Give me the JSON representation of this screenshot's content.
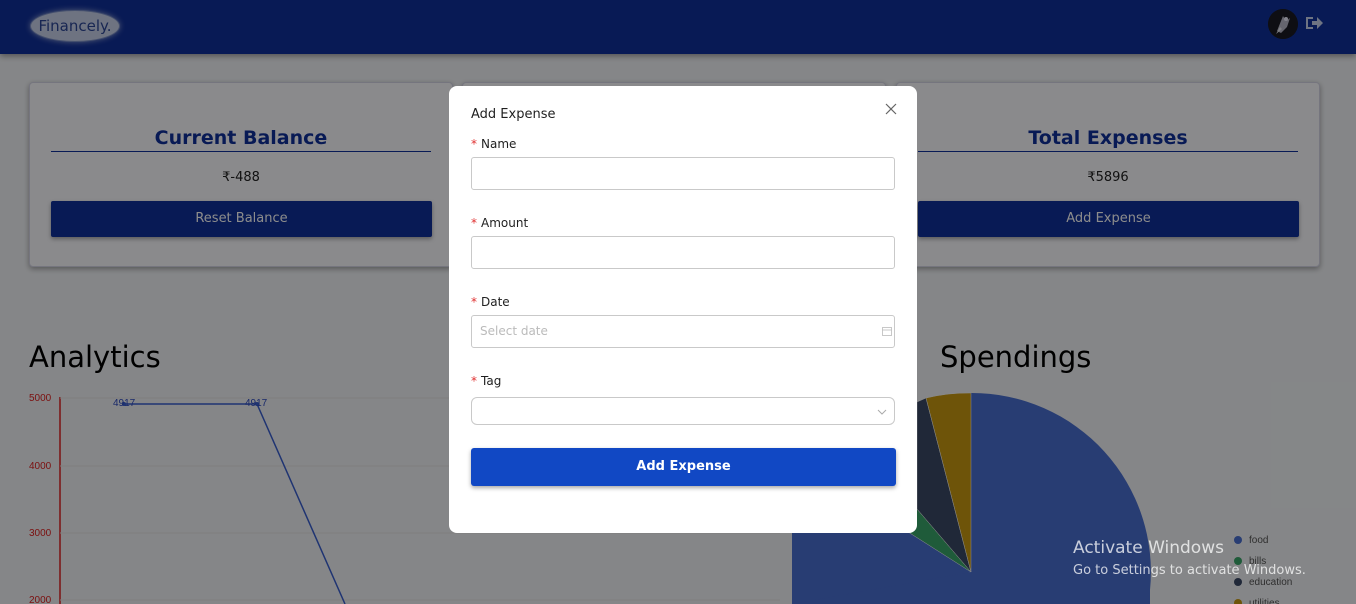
{
  "navbar": {
    "logo": "Financely."
  },
  "cards": [
    {
      "title": "Current Balance",
      "value": "₹-488",
      "button": "Reset Balance"
    },
    {
      "title": "Total Expenses",
      "value": "₹5896",
      "button": "Add Expense"
    }
  ],
  "analytics": {
    "title": "Analytics",
    "y_ticks": [
      "5000",
      "4000",
      "3000",
      "2000"
    ],
    "point_labels": [
      "4917",
      "4917"
    ]
  },
  "spendings": {
    "title": "Spendings",
    "legend": [
      "food",
      "bills",
      "education",
      "utilities"
    ]
  },
  "modal": {
    "title": "Add Expense",
    "fields": [
      {
        "label": "Name",
        "value": "",
        "placeholder": ""
      },
      {
        "label": "Amount",
        "value": "",
        "placeholder": ""
      },
      {
        "label": "Date",
        "value": "",
        "placeholder": "Select date"
      },
      {
        "label": "Tag",
        "value": "",
        "placeholder": ""
      }
    ],
    "submit": "Add Expense"
  },
  "watermark": {
    "title": "Activate Windows",
    "subtitle": "Go to Settings to activate Windows."
  },
  "colors": {
    "navbar": "#10309b",
    "primary_button": "#1148c4",
    "required_marker": "#e03131",
    "chart_line": "#3a5fd0",
    "axis_ticks": "#e02020",
    "pie_food": "#4a6fd1",
    "pie_bills": "#3aa66a",
    "pie_education": "#3b4a66",
    "pie_utilities": "#c89a12"
  }
}
